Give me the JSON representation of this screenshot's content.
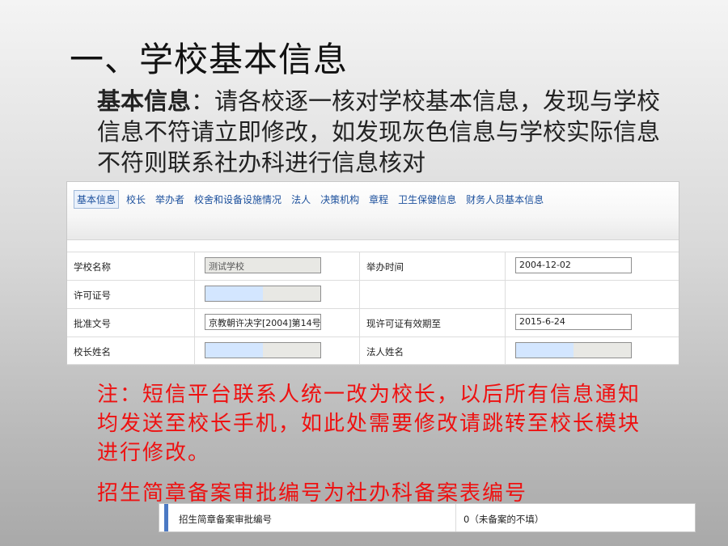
{
  "slide": {
    "title": "一、学校基本信息",
    "intro_bold": "基本信息",
    "intro_text": "：请各校逐一核对学校基本信息，发现与学校信息不符请立即修改，如发现灰色信息与学校实际信息不符则联系社办科进行信息核对",
    "note": "注：短信平台联系人统一改为校长，以后所有信息通知均发送至校长手机，如此处需要修改请跳转至校长模块进行修改。",
    "note2": "招生简章备案审批编号为社办科备案表编号"
  },
  "tabs": [
    "基本信息",
    "校长",
    "举办者",
    "校舍和设备设施情况",
    "法人",
    "决策机构",
    "章程",
    "卫生保健信息",
    "财务人员基本信息"
  ],
  "form": {
    "school_name_label": "学校名称",
    "school_name_value": "测试学校",
    "founded_label": "举办时间",
    "founded_value": "2004-12-02",
    "license_label": "许可证号",
    "approval_label": "批准文号",
    "approval_value": "京教朝许决字[2004]第14号",
    "license_valid_label": "现许可证有效期至",
    "license_valid_value": "2015-6-24",
    "principal_label": "校长姓名",
    "legal_person_label": "法人姓名",
    "fill_fraction": 0.5
  },
  "recruit": {
    "label": "招生简章备案审批编号",
    "value": "0（未备案的不填）"
  },
  "colors": {
    "note_red": "#ee1111",
    "tab_blue": "#1b4f9c",
    "field_highlight": "#d3e6ff"
  }
}
